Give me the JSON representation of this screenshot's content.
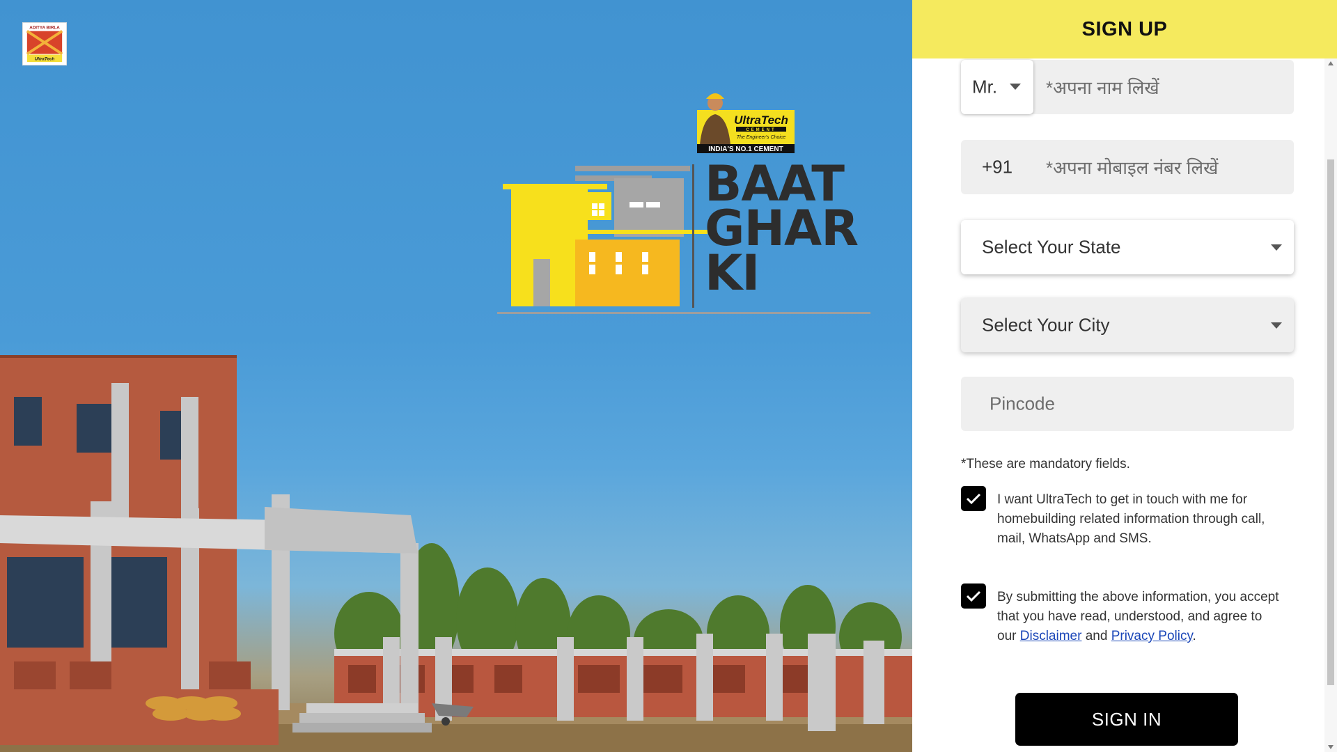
{
  "header": {
    "title": "SIGN UP"
  },
  "brand": {
    "corner_logo_top": "ADITYA BIRLA",
    "corner_logo_bottom": "UltraTech",
    "badge_name": "UltraTech",
    "badge_sub": "CEMENT",
    "badge_tagline": "The Engineer's Choice",
    "badge_claim": "INDIA'S NO.1 CEMENT",
    "campaign_line1": "BAAT",
    "campaign_line2": "GHAR",
    "campaign_line3": "KI"
  },
  "form": {
    "salutation": "Mr.",
    "name_placeholder": "*अपना नाम लिखें",
    "country_code": "+91",
    "mobile_placeholder": "*अपना मोबाइल नंबर लिखें",
    "state_placeholder": "Select Your State",
    "city_placeholder": "Select Your City",
    "pincode_placeholder": "Pincode",
    "mandatory_note": "*These are mandatory fields.",
    "consent_contact": "I want UltraTech to get in touch with me for homebuilding related information through call, mail, WhatsApp and SMS.",
    "consent_terms_prefix": "By submitting the above information, you accept that you have read, understood, and agree to our",
    "consent_terms_link1": "Disclaimer",
    "consent_terms_and": "and",
    "consent_terms_link2": "Privacy Policy",
    "consent_terms_suffix": ".",
    "submit_label": "SIGN IN"
  },
  "colors": {
    "header_yellow": "#f5ea5e",
    "sky_blue": "#4193d1",
    "button_black": "#000000",
    "link_blue": "#1a46b8"
  }
}
